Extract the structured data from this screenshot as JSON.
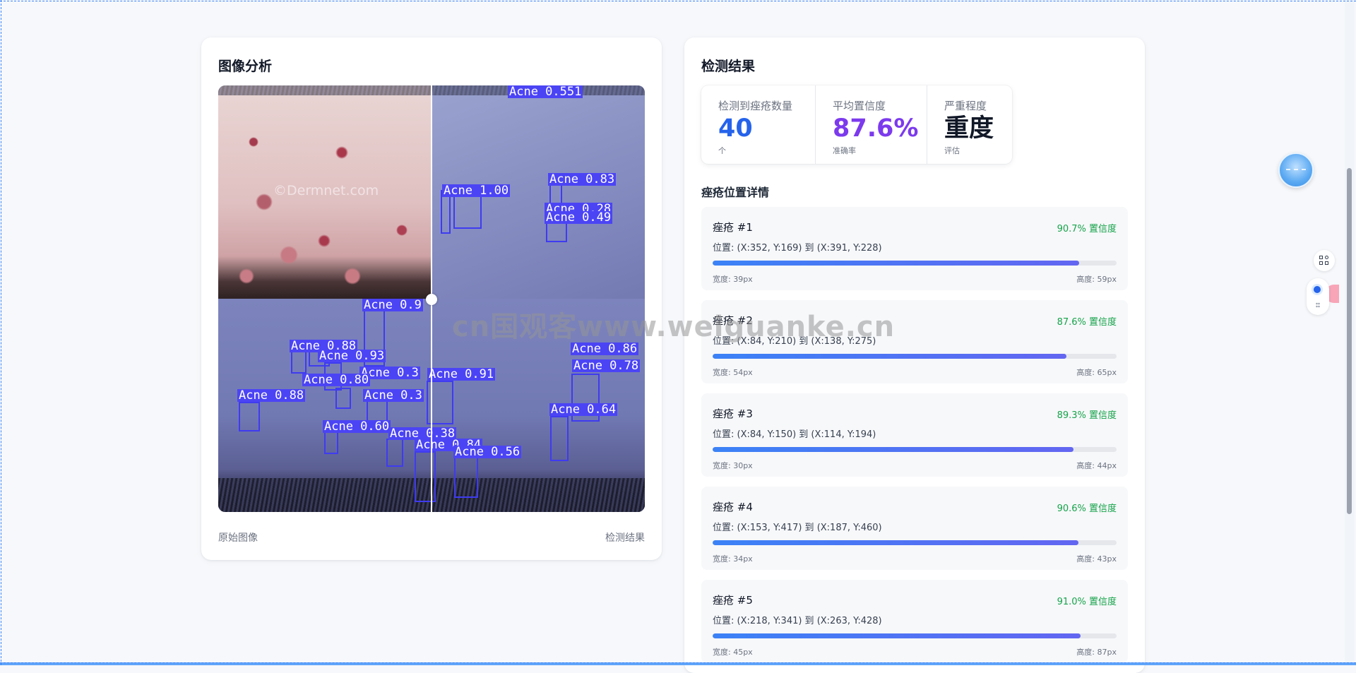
{
  "analysis": {
    "title": "图像分析",
    "caption_original": "原始图像",
    "caption_result": "检测结果",
    "image_watermark": "©Dermnet.com",
    "detections": [
      "Acne 0.551",
      "Acne 1.00",
      "Acne 0.83",
      "Acne 0.28",
      "Acne 0.49",
      "Acne 0.9",
      "Acne 0.88",
      "Acne 0.93",
      "Acne 0.3",
      "Acne 0.91",
      "Acne 0.80",
      "Acne 0.88",
      "Acne 0.3",
      "Acne 0.86",
      "Acne 0.78",
      "Acne 0.64",
      "Acne 0.60",
      "Acne 0.38",
      "Acne 0.84",
      "Acne 0.56"
    ]
  },
  "results": {
    "title": "检测结果",
    "stats": {
      "count": {
        "label": "检测到痤疮数量",
        "value": "40",
        "unit": "个"
      },
      "confidence": {
        "label": "平均置信度",
        "value": "87.6%",
        "unit": "准确率"
      },
      "severity": {
        "label": "严重程度",
        "value": "重度",
        "unit": "评估"
      }
    },
    "section_title": "痤疮位置详情",
    "items": [
      {
        "name": "痤疮 #1",
        "confidence": "90.7% 置信度",
        "position": "位置: (X:352, Y:169) 到 (X:391, Y:228)",
        "width": "宽度: 39px",
        "height": "高度: 59px",
        "fill": 0.907
      },
      {
        "name": "痤疮 #2",
        "confidence": "87.6% 置信度",
        "position": "位置: (X:84, Y:210) 到 (X:138, Y:275)",
        "width": "宽度: 54px",
        "height": "高度: 65px",
        "fill": 0.876
      },
      {
        "name": "痤疮 #3",
        "confidence": "89.3% 置信度",
        "position": "位置: (X:84, Y:150) 到 (X:114, Y:194)",
        "width": "宽度: 30px",
        "height": "高度: 44px",
        "fill": 0.893
      },
      {
        "name": "痤疮 #4",
        "confidence": "90.6% 置信度",
        "position": "位置: (X:153, Y:417) 到 (X:187, Y:460)",
        "width": "宽度: 34px",
        "height": "高度: 43px",
        "fill": 0.906
      },
      {
        "name": "痤疮 #5",
        "confidence": "91.0% 置信度",
        "position": "位置: (X:218, Y:341) 到 (X:263, Y:428)",
        "width": "宽度: 45px",
        "height": "高度: 87px",
        "fill": 0.91
      }
    ]
  },
  "overlay_watermark": "cn国观客www.weiguanke.cn",
  "colors": {
    "accent_blue": "#2563eb",
    "accent_purple": "#7c3aed",
    "confidence_green": "#16a34a",
    "detection_box": "#3f3bf0"
  },
  "icons": [
    "grid-add-icon",
    "chat-bubble-icon",
    "drag-handle-icon",
    "floating-assistant-icon"
  ]
}
